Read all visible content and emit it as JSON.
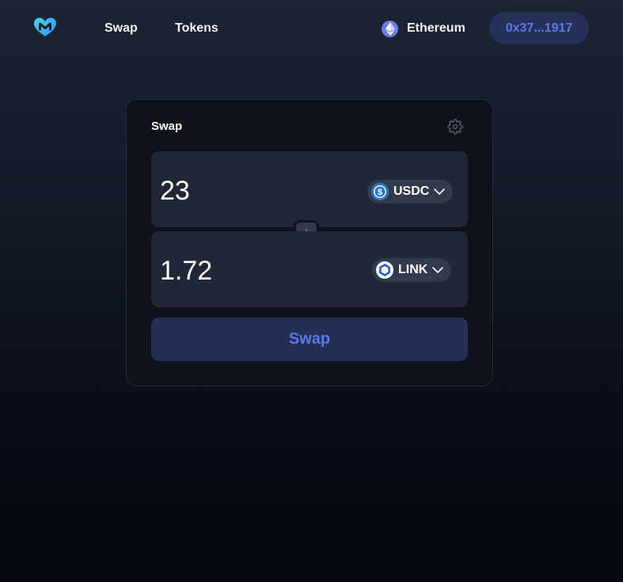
{
  "header": {
    "logo_icon": "m-heart-logo-icon",
    "nav": [
      {
        "label": "Swap"
      },
      {
        "label": "Tokens"
      }
    ],
    "network": {
      "label": "Ethereum",
      "icon": "ethereum-icon"
    },
    "wallet": {
      "label": "0x37...1917"
    }
  },
  "swap_card": {
    "title": "Swap",
    "settings_icon": "gear-icon",
    "from": {
      "amount": "23",
      "token": "USDC",
      "icon": "usdc-icon"
    },
    "to": {
      "amount": "1.72",
      "token": "LINK",
      "icon": "chainlink-icon"
    },
    "flip_icon": "arrow-down-icon",
    "swap_button": "Swap"
  },
  "colors": {
    "accent": "#5a78ea",
    "wallet_bg": "#253158",
    "card_bg": "#0f121b",
    "panel_bg": "#222738",
    "logo_gradient_start": "#4ad9f0",
    "logo_gradient_end": "#2a8ff0"
  }
}
